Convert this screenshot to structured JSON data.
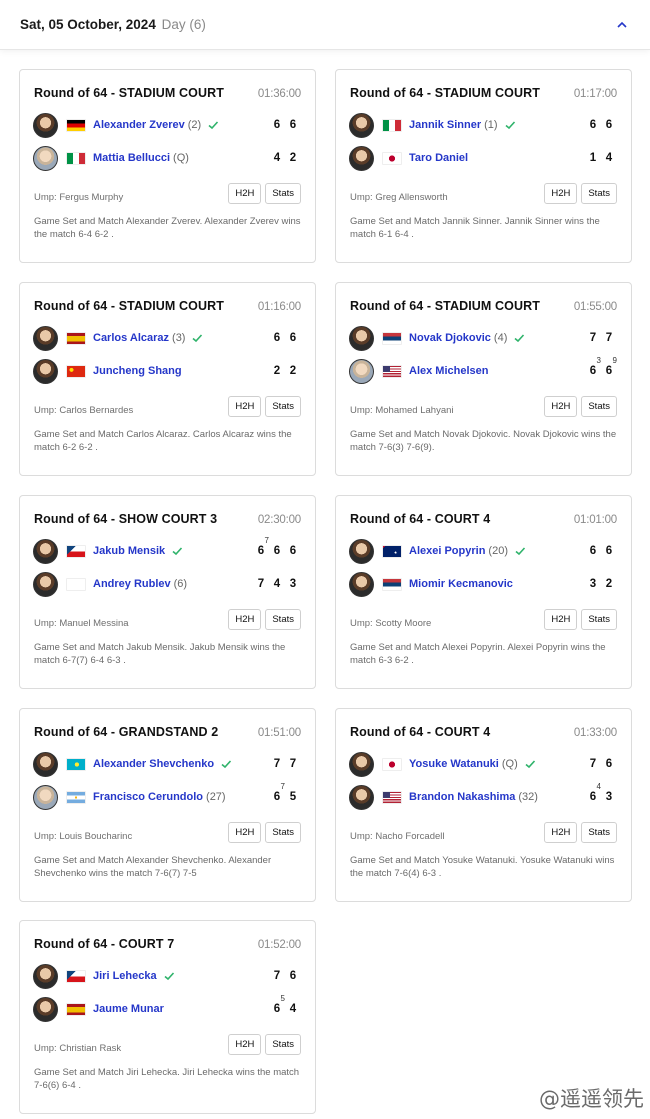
{
  "header": {
    "date": "Sat, 05 October, 2024",
    "day": "Day (6)"
  },
  "matches": [
    {
      "round": "Round of 64 - STADIUM COURT",
      "duration": "01:36:00",
      "p1": {
        "name": "Alexander Zverev",
        "seed": "(2)",
        "flag": "de",
        "winner": true,
        "scores": [
          {
            "v": "6"
          },
          {
            "v": "6"
          }
        ]
      },
      "p2": {
        "name": "Mattia Bellucci",
        "seed": "(Q)",
        "flag": "it",
        "winner": false,
        "scores": [
          {
            "v": "4"
          },
          {
            "v": "2"
          }
        ]
      },
      "ump": "Ump: Fergus Murphy",
      "summary": "Game Set and Match Alexander Zverev. Alexander Zverev wins the match 6-4 6-2 ."
    },
    {
      "round": "Round of 64 - STADIUM COURT",
      "duration": "01:17:00",
      "p1": {
        "name": "Jannik Sinner",
        "seed": "(1)",
        "flag": "it",
        "winner": true,
        "scores": [
          {
            "v": "6"
          },
          {
            "v": "6"
          }
        ]
      },
      "p2": {
        "name": "Taro Daniel",
        "seed": "",
        "flag": "jp",
        "winner": false,
        "scores": [
          {
            "v": "1"
          },
          {
            "v": "4"
          }
        ]
      },
      "ump": "Ump: Greg Allensworth",
      "summary": "Game Set and Match Jannik Sinner. Jannik Sinner wins the match 6-1 6-4 ."
    },
    {
      "round": "Round of 64 - STADIUM COURT",
      "duration": "01:16:00",
      "p1": {
        "name": "Carlos Alcaraz",
        "seed": "(3)",
        "flag": "es",
        "winner": true,
        "scores": [
          {
            "v": "6"
          },
          {
            "v": "6"
          }
        ]
      },
      "p2": {
        "name": "Juncheng Shang",
        "seed": "",
        "flag": "cn",
        "winner": false,
        "scores": [
          {
            "v": "2"
          },
          {
            "v": "2"
          }
        ]
      },
      "ump": "Ump: Carlos Bernardes",
      "summary": "Game Set and Match Carlos Alcaraz. Carlos Alcaraz wins the match 6-2 6-2 ."
    },
    {
      "round": "Round of 64 - STADIUM COURT",
      "duration": "01:55:00",
      "p1": {
        "name": "Novak Djokovic",
        "seed": "(4)",
        "flag": "rs",
        "winner": true,
        "scores": [
          {
            "v": "7"
          },
          {
            "v": "7"
          }
        ]
      },
      "p2": {
        "name": "Alex Michelsen",
        "seed": "",
        "flag": "us",
        "winner": false,
        "scores": [
          {
            "v": "6",
            "tb": "3"
          },
          {
            "v": "6",
            "tb": "9"
          }
        ]
      },
      "ump": "Ump: Mohamed Lahyani",
      "summary": "Game Set and Match Novak Djokovic. Novak Djokovic wins the match 7-6(3) 7-6(9)."
    },
    {
      "round": "Round of 64 - SHOW COURT 3",
      "duration": "02:30:00",
      "p1": {
        "name": "Jakub Mensik",
        "seed": "",
        "flag": "cz",
        "winner": true,
        "scores": [
          {
            "v": "6",
            "tb": "7"
          },
          {
            "v": "6"
          },
          {
            "v": "6"
          }
        ]
      },
      "p2": {
        "name": "Andrey Rublev",
        "seed": "(6)",
        "flag": "blank",
        "winner": false,
        "scores": [
          {
            "v": "7"
          },
          {
            "v": "4"
          },
          {
            "v": "3"
          }
        ]
      },
      "ump": "Ump: Manuel Messina",
      "summary": "Game Set and Match Jakub Mensik. Jakub Mensik wins the match 6-7(7) 6-4 6-3 ."
    },
    {
      "round": "Round of 64 - COURT 4",
      "duration": "01:01:00",
      "p1": {
        "name": "Alexei Popyrin",
        "seed": "(20)",
        "flag": "au",
        "winner": true,
        "scores": [
          {
            "v": "6"
          },
          {
            "v": "6"
          }
        ]
      },
      "p2": {
        "name": "Miomir Kecmanovic",
        "seed": "",
        "flag": "rs",
        "winner": false,
        "scores": [
          {
            "v": "3"
          },
          {
            "v": "2"
          }
        ]
      },
      "ump": "Ump: Scotty Moore",
      "summary": "Game Set and Match Alexei Popyrin. Alexei Popyrin wins the match 6-3 6-2 ."
    },
    {
      "round": "Round of 64 - GRANDSTAND 2",
      "duration": "01:51:00",
      "p1": {
        "name": "Alexander Shevchenko",
        "seed": "",
        "flag": "kz",
        "winner": true,
        "scores": [
          {
            "v": "7"
          },
          {
            "v": "7"
          }
        ]
      },
      "p2": {
        "name": "Francisco Cerundolo",
        "seed": "(27)",
        "flag": "ar",
        "winner": false,
        "scores": [
          {
            "v": "6",
            "tb": "7"
          },
          {
            "v": "5"
          }
        ]
      },
      "ump": "Ump: Louis Boucharinc",
      "summary": "Game Set and Match Alexander Shevchenko. Alexander Shevchenko wins the match 7-6(7) 7-5"
    },
    {
      "round": "Round of 64 - COURT 4",
      "duration": "01:33:00",
      "p1": {
        "name": "Yosuke Watanuki",
        "seed": "(Q)",
        "flag": "jp",
        "winner": true,
        "scores": [
          {
            "v": "7"
          },
          {
            "v": "6"
          }
        ]
      },
      "p2": {
        "name": "Brandon Nakashima",
        "seed": "(32)",
        "flag": "us",
        "winner": false,
        "scores": [
          {
            "v": "6",
            "tb": "4"
          },
          {
            "v": "3"
          }
        ]
      },
      "ump": "Ump: Nacho Forcadell",
      "summary": "Game Set and Match Yosuke Watanuki. Yosuke Watanuki wins the match 7-6(4) 6-3 ."
    },
    {
      "round": "Round of 64 - COURT 7",
      "duration": "01:52:00",
      "p1": {
        "name": "Jiri Lehecka",
        "seed": "",
        "flag": "cz",
        "winner": true,
        "scores": [
          {
            "v": "7"
          },
          {
            "v": "6"
          }
        ]
      },
      "p2": {
        "name": "Jaume Munar",
        "seed": "",
        "flag": "es",
        "winner": false,
        "scores": [
          {
            "v": "6",
            "tb": "5"
          },
          {
            "v": "4"
          }
        ]
      },
      "ump": "Ump: Christian Rask",
      "summary": "Game Set and Match Jiri Lehecka. Jiri Lehecka wins the match 7-6(6) 6-4 ."
    }
  ],
  "labels": {
    "h2h": "H2H",
    "stats": "Stats"
  },
  "watermark": "@遥遥领先",
  "colors": {
    "player_link": "#2537c9",
    "check": "#2fb36b"
  }
}
